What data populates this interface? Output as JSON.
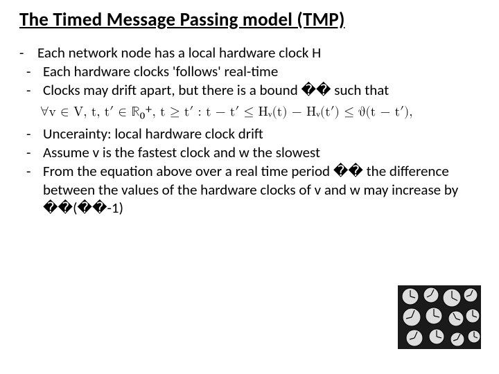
{
  "title": "The Timed Message Passing model (TMP)",
  "lines": {
    "l0": "Each network node has a local hardware clock H",
    "l1": "Each hardware clocks 'follows' real-time",
    "l2": "Clocks may drift apart, but there is a bound �� such that",
    "eq": "∀v ∈ V, t, t′ ∈ ℝ₀⁺, t ≥ t′ : t − t′ ≤ Hᵥ(t) − Hᵥ(t′) ≤ ϑ(t − t′),",
    "l3": "Uncerainty: local hardware clock drift",
    "l4": "Assume v is the fastest clock and w the slowest",
    "l5": "From the equation above over a real time period �� the difference between the values of the hardware clocks of v and w                                            may increase by ��(��-1)"
  },
  "dash": "-"
}
